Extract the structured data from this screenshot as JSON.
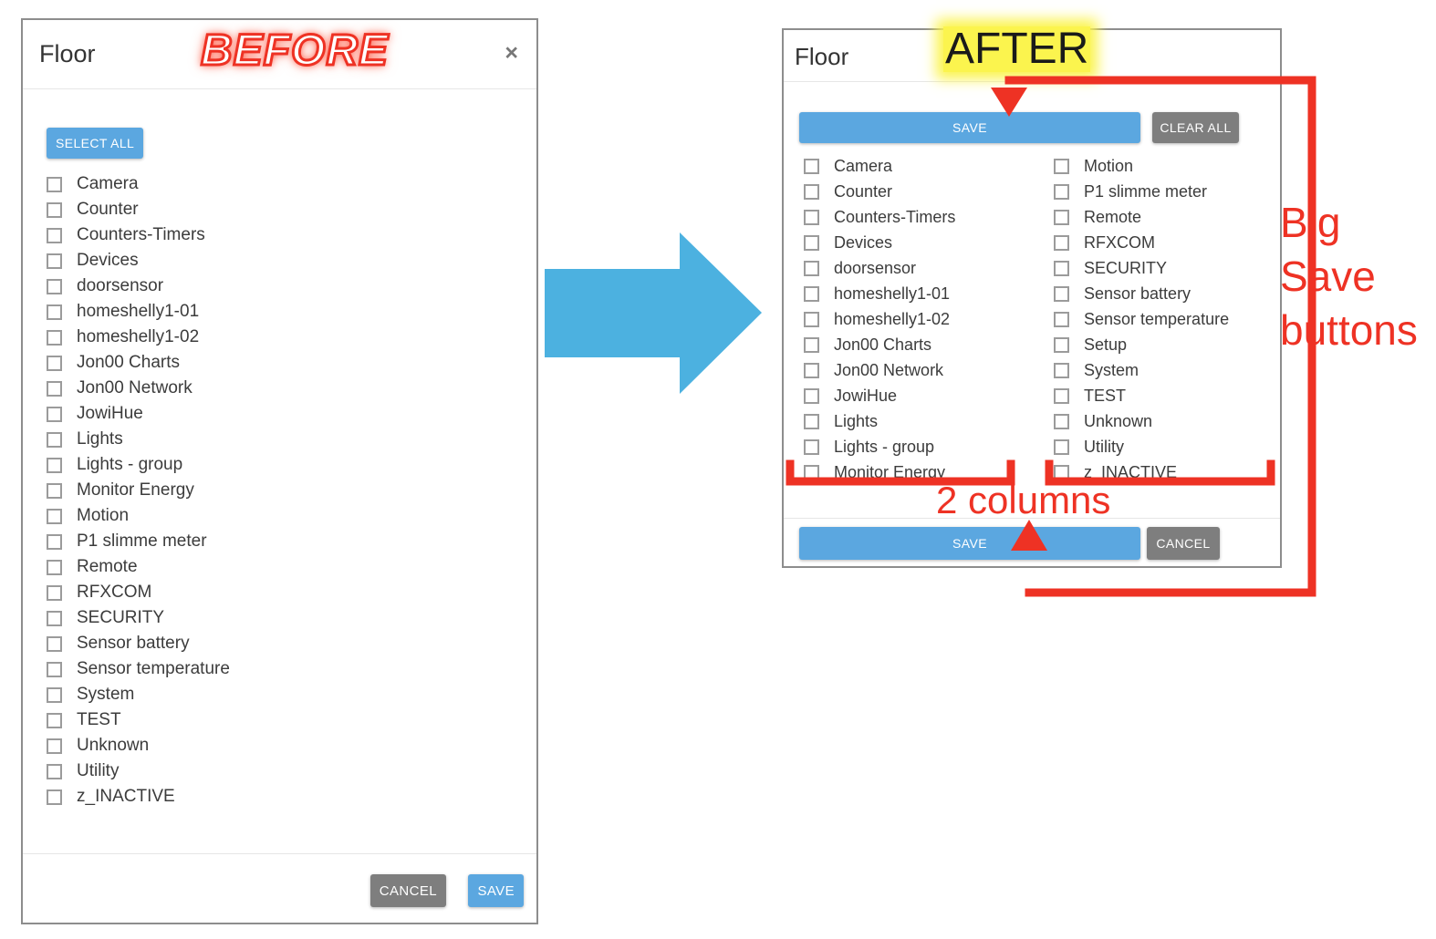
{
  "annotations": {
    "before_badge": "BEFORE",
    "after_badge": "AFTER",
    "big_save_line1": "Big",
    "big_save_line2": "Save",
    "big_save_line3": "buttons",
    "two_columns": "2 columns",
    "accent_red": "#ee3224",
    "highlight_yellow": "#fbf44e",
    "arrow_blue": "#4cb1e0"
  },
  "before_dialog": {
    "title": "Floor",
    "close_label": "×",
    "select_all_label": "SELECT ALL",
    "items": [
      "Camera",
      "Counter",
      "Counters-Timers",
      "Devices",
      "doorsensor",
      "homeshelly1-01",
      "homeshelly1-02",
      "Jon00 Charts",
      "Jon00 Network",
      "JowiHue",
      "Lights",
      "Lights - group",
      "Monitor Energy",
      "Motion",
      "P1 slimme meter",
      "Remote",
      "RFXCOM",
      "SECURITY",
      "Sensor battery",
      "Sensor temperature",
      "System",
      "TEST",
      "Unknown",
      "Utility",
      "z_INACTIVE"
    ],
    "cancel_label": "CANCEL",
    "save_label": "SAVE"
  },
  "after_dialog": {
    "title": "Floor",
    "save_top_label": "SAVE",
    "clear_all_label": "CLEAR ALL",
    "column_left": [
      "Camera",
      "Counter",
      "Counters-Timers",
      "Devices",
      "doorsensor",
      "homeshelly1-01",
      "homeshelly1-02",
      "Jon00 Charts",
      "Jon00 Network",
      "JowiHue",
      "Lights",
      "Lights - group",
      "Monitor Energy"
    ],
    "column_right": [
      "Motion",
      "P1 slimme meter",
      "Remote",
      "RFXCOM",
      "SECURITY",
      "Sensor battery",
      "Sensor temperature",
      "Setup",
      "System",
      "TEST",
      "Unknown",
      "Utility",
      "z_INACTIVE"
    ],
    "save_bottom_label": "SAVE",
    "cancel_label": "CANCEL"
  }
}
